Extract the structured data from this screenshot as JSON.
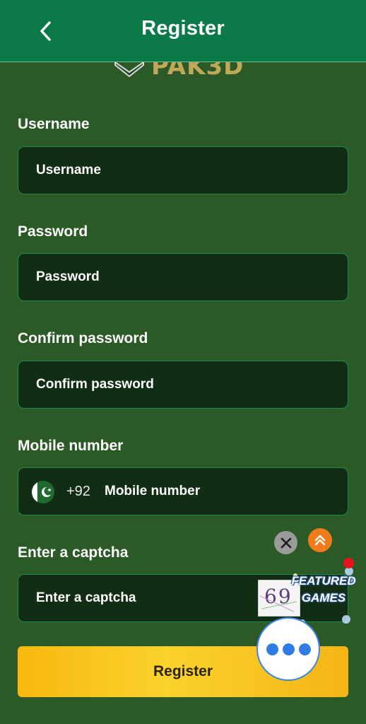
{
  "header": {
    "title": "Register"
  },
  "logo": {
    "text": "PAK3D"
  },
  "form": {
    "username": {
      "label": "Username",
      "placeholder": "Username"
    },
    "password": {
      "label": "Password",
      "placeholder": "Password"
    },
    "confirm_password": {
      "label": "Confirm password",
      "placeholder": "Confirm password"
    },
    "mobile": {
      "label": "Mobile number",
      "country_code": "+92",
      "placeholder": "Mobile number"
    },
    "captcha": {
      "label": "Enter a captcha",
      "placeholder": "Enter a captcha",
      "image_text": "69"
    },
    "submit_label": "Register"
  },
  "floating": {
    "featured_line1": "FEATURED",
    "featured_line2": "GAMES"
  },
  "colors": {
    "header_bg": "#0b7a48",
    "page_bg": "#2b5a26",
    "field_bg": "#112d13",
    "field_border": "#1f8a4c",
    "button_bg": "#f7c21c",
    "scroll_top": "#f07b1a"
  },
  "icons": {
    "back": "chevron-left-icon",
    "flag": "pakistan-flag-icon",
    "close": "close-icon",
    "scroll_top": "double-chevron-up-icon",
    "chat": "more-dots-icon"
  }
}
